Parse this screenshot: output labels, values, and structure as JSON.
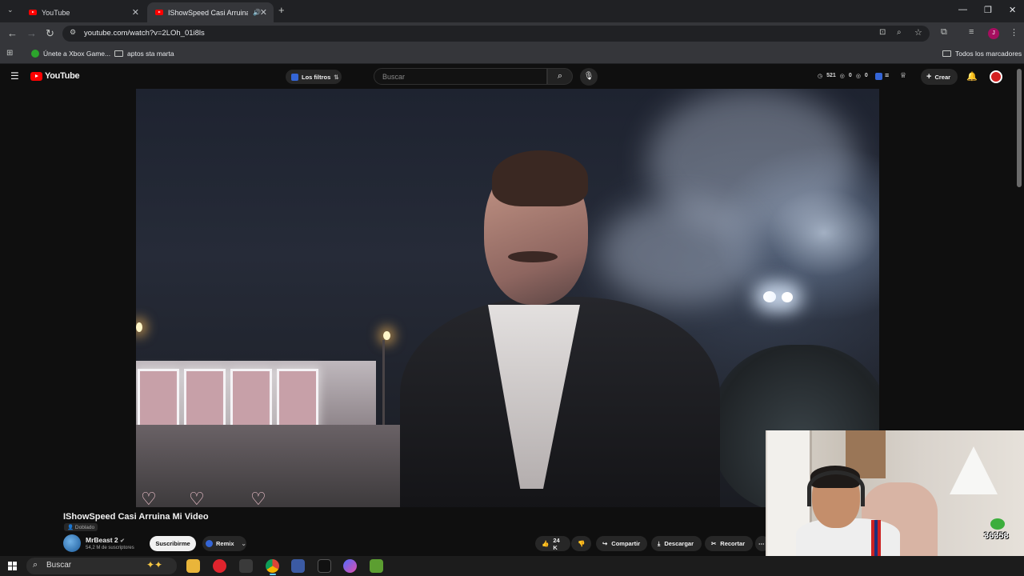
{
  "browser": {
    "tabs": [
      {
        "label": "YouTube",
        "active": false
      },
      {
        "label": "IShowSpeed Casi Arruina M",
        "active": true
      }
    ],
    "url": "youtube.com/watch?v=2LOh_01i8ls",
    "bookmarks": [
      {
        "label": "Únete a Xbox Game..."
      },
      {
        "label": "aptos sta marta"
      }
    ],
    "all_bookmarks": "Todos los marcadores",
    "profile_initial": "J"
  },
  "youtube": {
    "logo": "YouTube",
    "filters_chip": "Los filtros",
    "search_placeholder": "Buscar",
    "stats": {
      "a": "521",
      "b": "0",
      "c": "0"
    },
    "create_label": "Crear"
  },
  "video": {
    "title": "IShowSpeed Casi Arruina Mi Video",
    "dub_badge": "Doblado",
    "channel_name": "MrBeast 2",
    "subscribers": "54,2 M de suscriptores",
    "subscribe_label": "Suscribirme",
    "remix_label": "Remix",
    "likes": "24 K",
    "share_label": "Compartir",
    "download_label": "Descargar",
    "clip_label": "Recortar"
  },
  "overlay": {
    "score": "36358"
  },
  "taskbar": {
    "search_label": "Buscar"
  },
  "colors": {
    "yt_red": "#ff0000",
    "yt_bg": "#0f0f0f",
    "chrome_bar": "#35363a"
  }
}
